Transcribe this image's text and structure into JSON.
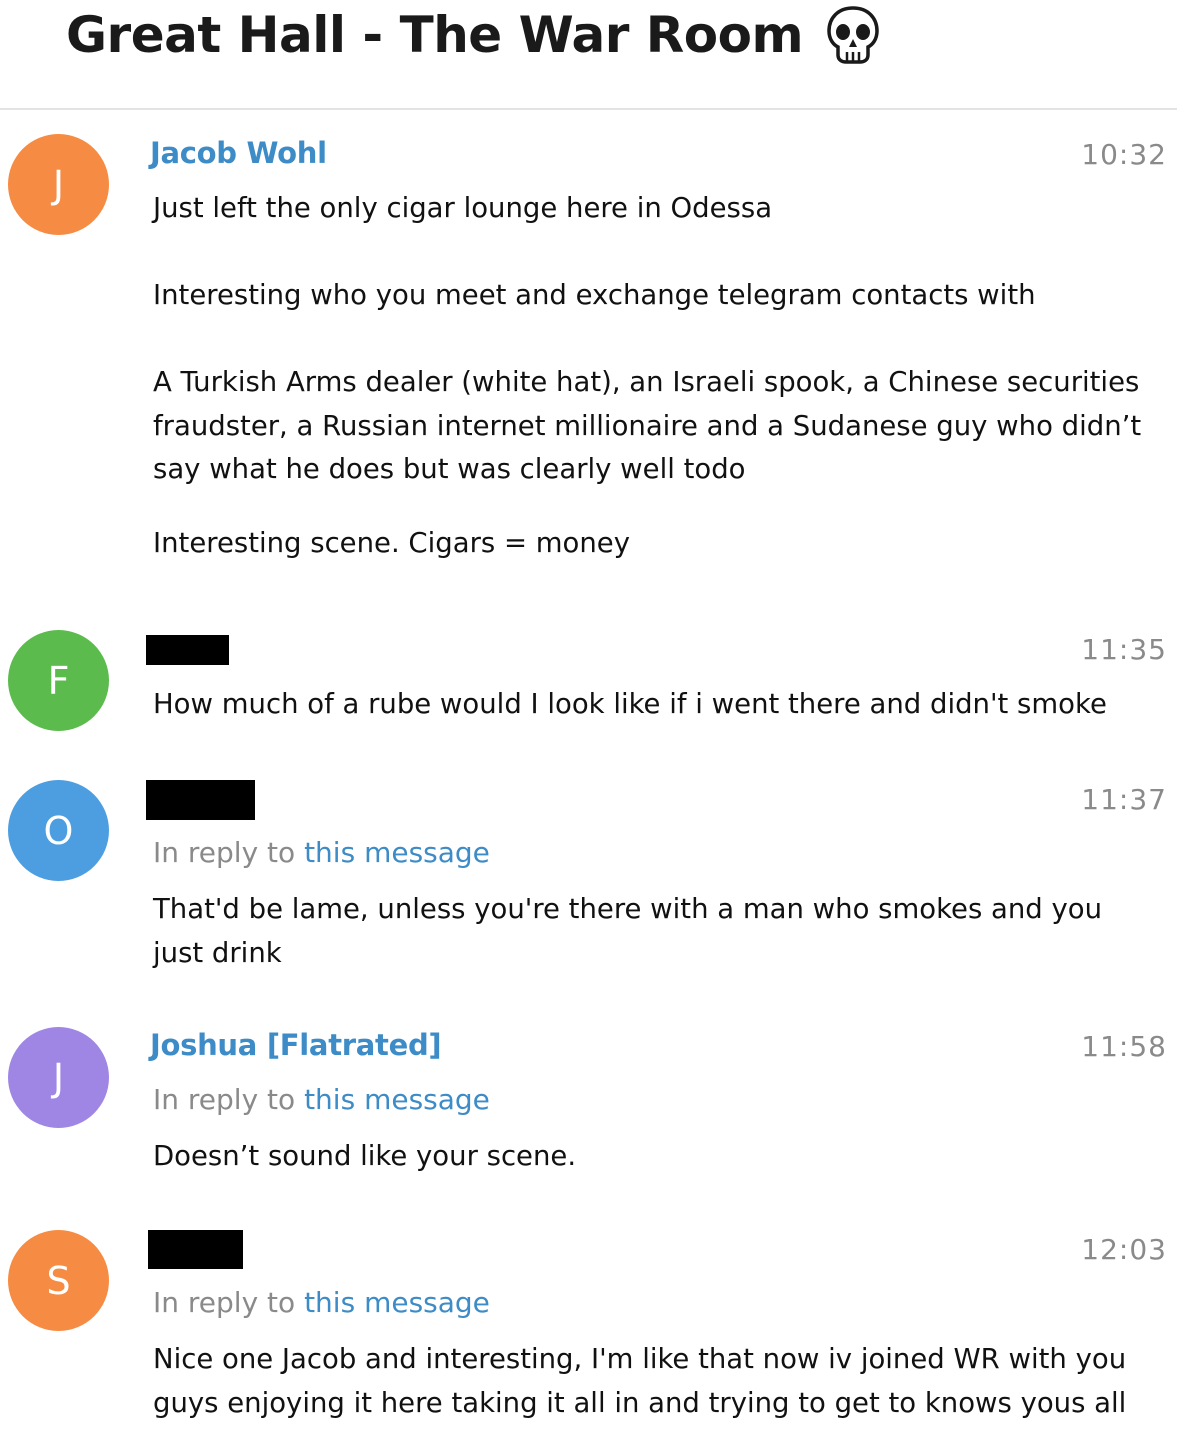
{
  "chat": {
    "title": "Great Hall - The War Room",
    "title_icon": "skull-icon"
  },
  "messages": [
    {
      "avatar_letter": "J",
      "avatar_color": "#f68b43",
      "sender": "Jacob Wohl",
      "sender_color": "#3d8cc7",
      "time": "10:32",
      "paragraphs": [
        [
          "Just left the only cigar lounge here in Odessa"
        ],
        [
          "Interesting who you meet and exchange telegram contacts with"
        ],
        [
          "A Turkish Arms dealer (white hat), an Israeli spook, a Chinese securities",
          "fraudster, a Russian internet millionaire and a Sudanese guy who didn’t",
          "say what he does but was clearly well todo"
        ],
        [
          "Interesting scene. Cigars = money"
        ]
      ]
    },
    {
      "avatar_letter": "F",
      "avatar_color": "#5cbb4d",
      "sender_redacted": true,
      "time": "11:35",
      "paragraphs": [
        [
          "How much of a rube would I look like if i went there and didn't smoke"
        ]
      ]
    },
    {
      "avatar_letter": "O",
      "avatar_color": "#4d9ee0",
      "sender_redacted": true,
      "time": "11:37",
      "reply_prefix": "In reply to",
      "reply_link": "this message",
      "paragraphs": [
        [
          "That'd be lame, unless you're there with a man who smokes and you",
          "just drink"
        ]
      ]
    },
    {
      "avatar_letter": "J",
      "avatar_color": "#9f86e4",
      "sender": "Joshua [Flatrated]",
      "sender_color": "#3d8cc7",
      "time": "11:58",
      "reply_prefix": "In reply to",
      "reply_link": "this message",
      "paragraphs": [
        [
          "Doesn’t sound like your scene."
        ]
      ]
    },
    {
      "avatar_letter": "S",
      "avatar_color": "#f68b43",
      "sender_redacted": true,
      "time": "12:03",
      "reply_prefix": "In reply to",
      "reply_link": "this message",
      "paragraphs": [
        [
          "Nice one Jacob and interesting, I'm like that now iv joined WR with you",
          "guys enjoying it here taking it all in and trying to get to knows yous all"
        ]
      ]
    }
  ]
}
